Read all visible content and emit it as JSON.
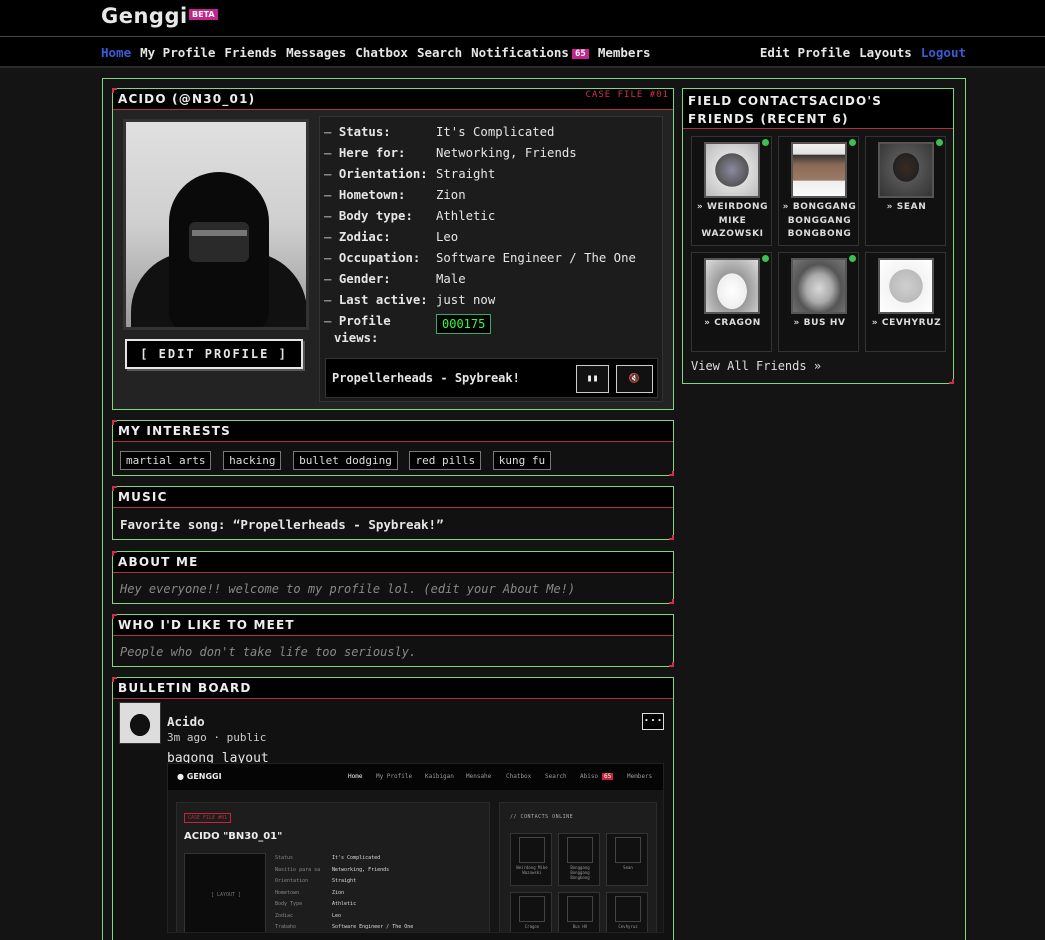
{
  "header": {
    "logo": "Genggi",
    "beta": "BETA"
  },
  "nav": {
    "left": [
      "Home",
      "My Profile",
      "Friends",
      "Messages",
      "Chatbox",
      "Search",
      "Notifications",
      "Members"
    ],
    "notif_count": "65",
    "right": [
      "Edit Profile",
      "Layouts",
      "Logout"
    ]
  },
  "profile": {
    "title": "ACIDO (@N30_01)",
    "case_file": "CASE FILE #01",
    "edit_button": "[ EDIT PROFILE ]",
    "details": [
      {
        "key": "Status:",
        "value": "It's Complicated"
      },
      {
        "key": "Here for:",
        "value": "Networking, Friends"
      },
      {
        "key": "Orientation:",
        "value": "Straight"
      },
      {
        "key": "Hometown:",
        "value": "Zion"
      },
      {
        "key": "Body type:",
        "value": "Athletic"
      },
      {
        "key": "Zodiac:",
        "value": "Leo"
      },
      {
        "key": "Occupation:",
        "value": "Software Engineer / The One"
      },
      {
        "key": "Gender:",
        "value": "Male"
      },
      {
        "key": "Last active:",
        "value": "just now"
      }
    ],
    "views_label_1": "Profile",
    "views_label_2": "views:",
    "views_count": "000175",
    "player_title": "Propellerheads - Spybreak!",
    "pause_icon": "▮▮",
    "mute_icon": "🔇"
  },
  "interests": {
    "title": "MY INTERESTS",
    "tags": [
      "martial arts",
      "hacking",
      "bullet dodging",
      "red pills",
      "kung fu"
    ]
  },
  "music": {
    "title": "MUSIC",
    "text": "Favorite song: “Propellerheads - Spybreak!”"
  },
  "about": {
    "title": "ABOUT ME",
    "text": "Hey everyone!! welcome to my profile lol. (edit your About Me!)"
  },
  "meet": {
    "title": "WHO I'D LIKE TO MEET",
    "text": "People who don't take life too seriously."
  },
  "bulletin": {
    "title": "BULLETIN BOARD",
    "author": "Acido",
    "meta": "3m ago · public",
    "menu": "···",
    "body": "bagong layout",
    "shot": {
      "logo": "● GENGGI",
      "nav": [
        "Home",
        "My Profile",
        "Kaibigan",
        "Mensahe",
        "Chatbox",
        "Search",
        "Abiso",
        "Members"
      ],
      "badge": "65",
      "case": "CASE FILE #01",
      "name": "ACIDO \"BN30_01\"",
      "contacts": "// CONTACTS ONLINE",
      "rows": [
        {
          "k": "Status",
          "v": "It's Complicated"
        },
        {
          "k": "Nasitio para sa",
          "v": "Networking, Friends"
        },
        {
          "k": "Orientation",
          "v": "Straight"
        },
        {
          "k": "Hometown",
          "v": "Zion"
        },
        {
          "k": "Body Type",
          "v": "Athletic"
        },
        {
          "k": "Zodiac",
          "v": "Leo"
        },
        {
          "k": "Trabaho",
          "v": "Software Engineer / The One"
        }
      ],
      "photo_label": "[ LAYOUT ]",
      "friends": [
        "Weirdong Mike Wazowski",
        "Bonggang Bonggang Bongbong",
        "Sean",
        "Cragon",
        "Bus HV",
        "Cevhyruz"
      ]
    }
  },
  "friends": {
    "title": "FIELD CONTACTSACIDO'S FRIENDS (RECENT 6)",
    "items": [
      {
        "name": "» WEIRDONG MIKE WAZOWSKI"
      },
      {
        "name": "» BONGGANG BONGGANG BONGBONG"
      },
      {
        "name": "» SEAN"
      },
      {
        "name": "» CRAGON"
      },
      {
        "name": "» BUS HV"
      },
      {
        "name": "» CEVHYRUZ"
      }
    ],
    "view_all": "View All Friends »"
  }
}
